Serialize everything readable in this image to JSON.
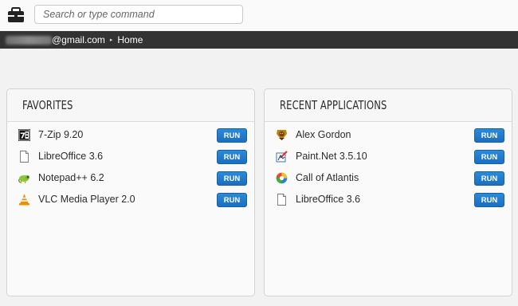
{
  "search": {
    "placeholder": "Search or type command"
  },
  "breadcrumb": {
    "email_suffix": "@gmail.com",
    "separator": "▸",
    "home": "Home"
  },
  "favorites": {
    "title": "FAVORITES",
    "items": [
      {
        "icon": "7zip-icon",
        "name": "7-Zip 9.20",
        "action": "RUN"
      },
      {
        "icon": "libreoffice-document-icon",
        "name": "LibreOffice 3.6",
        "action": "RUN"
      },
      {
        "icon": "notepadpp-chameleon-icon",
        "name": "Notepad++ 6.2",
        "action": "RUN"
      },
      {
        "icon": "vlc-cone-icon",
        "name": "VLC Media Player 2.0",
        "action": "RUN"
      }
    ]
  },
  "recent": {
    "title": "RECENT APPLICATIONS",
    "items": [
      {
        "icon": "alex-gordon-icon",
        "name": "Alex Gordon",
        "action": "RUN"
      },
      {
        "icon": "paintnet-icon",
        "name": "Paint.Net 3.5.10",
        "action": "RUN"
      },
      {
        "icon": "call-of-atlantis-icon",
        "name": "Call of Atlantis",
        "action": "RUN"
      },
      {
        "icon": "libreoffice-document-icon",
        "name": "LibreOffice 3.6",
        "action": "RUN"
      }
    ]
  },
  "colors": {
    "run_button": "#1f79c9",
    "navbar": "#333333",
    "background": "#f2f2f2"
  }
}
